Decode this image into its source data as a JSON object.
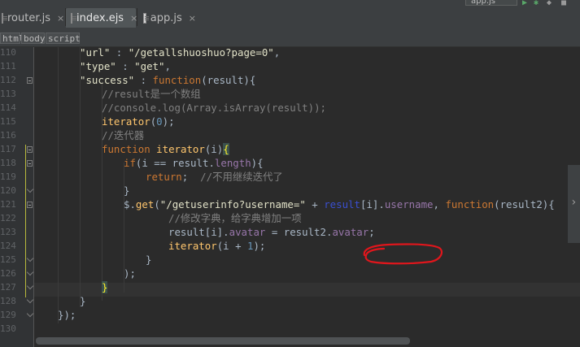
{
  "tabs": [
    {
      "label": "router.js",
      "close": "×",
      "active": false
    },
    {
      "label": "index.ejs",
      "close": "×",
      "active": true
    },
    {
      "label": "app.js",
      "close": "×",
      "active": false
    }
  ],
  "run_config": "app.js",
  "breadcrumbs": [
    "html",
    "body",
    "script"
  ],
  "line_numbers": [
    "110",
    "111",
    "112",
    "113",
    "114",
    "115",
    "116",
    "117",
    "118",
    "119",
    "120",
    "121",
    "122",
    "123",
    "124",
    "125",
    "126",
    "127",
    "128",
    "129",
    "130"
  ],
  "code": {
    "l110": {
      "key": "\"url\"",
      "colon": " : ",
      "val": "\"/getallshuoshuo?page=0\"",
      "end": ","
    },
    "l111": {
      "key": "\"type\"",
      "colon": " : ",
      "val": "\"get\"",
      "end": ","
    },
    "l112": {
      "key": "\"success\"",
      "colon": " : ",
      "kw": "function",
      "rest": "(result){"
    },
    "l113": {
      "comment": "//result是一个数组"
    },
    "l114": {
      "comment": "//console.log(Array.isArray(result));"
    },
    "l115": {
      "fn": "iterator",
      "rest": "(",
      "num": "0",
      "end": ");"
    },
    "l116": {
      "comment": "//迭代器"
    },
    "l117": {
      "kw": "function",
      "fn": " iterator",
      "rest": "(i)",
      "brace": "{"
    },
    "l118": {
      "kw": "if",
      "a": "(i == result.",
      "prop": "length",
      "b": "){"
    },
    "l119": {
      "kw": "return",
      "a": ";  ",
      "comment": "//不用继续迭代了"
    },
    "l120": {
      "a": "}"
    },
    "l121": {
      "a": "$.",
      "fn": "get",
      "b": "(",
      "str": "\"/getuserinfo?username=\"",
      "c": " + ",
      "d": "result",
      "e": "[i].",
      "prop": "username",
      "f": ", ",
      "kw": "function",
      "g": "(result2){"
    },
    "l122": {
      "comment": "//修改字典，给字典增加一项"
    },
    "l123": {
      "a": "result[i].",
      "prop": "avatar",
      "b": " = result2.",
      "prop2": "avatar",
      "c": ";"
    },
    "l124": {
      "fn": "iterator",
      "a": "(i + ",
      "num": "1",
      "b": ");"
    },
    "l125": {
      "a": "}"
    },
    "l126": {
      "a": ");"
    },
    "l127": {
      "brace": "}"
    },
    "l128": {
      "a": "}"
    },
    "l129": {
      "a": "});"
    }
  },
  "colors": {
    "background": "#2b2b2b",
    "keyword": "#cc7832",
    "function": "#ffc66d",
    "comment": "#808080",
    "string": "#e2e2c8",
    "annotation": "#e0161c"
  }
}
